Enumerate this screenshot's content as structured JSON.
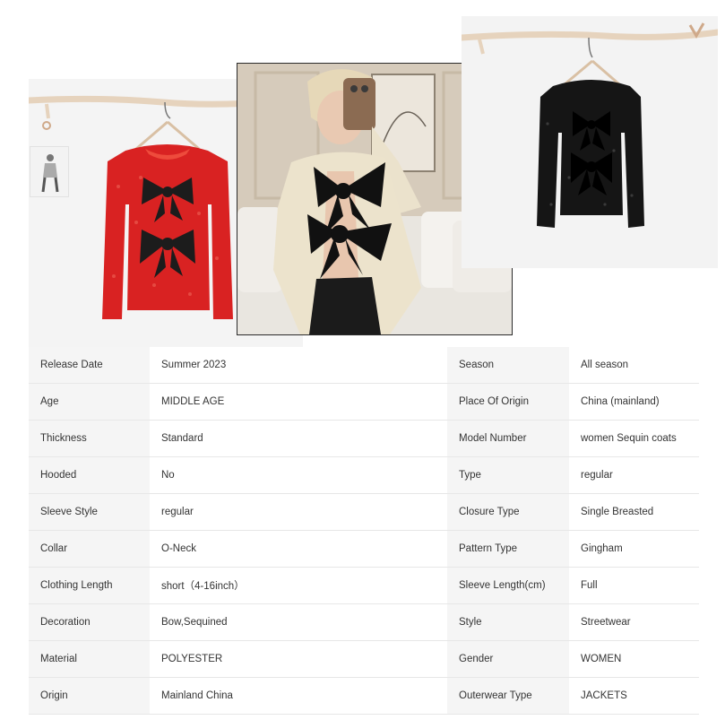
{
  "images": [
    {
      "name": "red-sequin-jacket",
      "description": "Red sequin cardigan with black bows on hanger"
    },
    {
      "name": "model-white-sequin-jacket",
      "description": "Woman taking mirror selfie in white sequin cardigan with black bows"
    },
    {
      "name": "black-sequin-jacket",
      "description": "Black sequin cardigan with black bows on hanger"
    }
  ],
  "colors": {
    "key_bg": "#f5f5f5",
    "value_bg": "#ffffff",
    "border": "#e7e7e7",
    "text": "#333333"
  },
  "specs": [
    {
      "k1": "Release Date",
      "v1": "Summer 2023",
      "k2": "Season",
      "v2": "All season"
    },
    {
      "k1": "Age",
      "v1": "MIDDLE AGE",
      "k2": "Place Of Origin",
      "v2": "China (mainland)"
    },
    {
      "k1": "Thickness",
      "v1": "Standard",
      "k2": "Model Number",
      "v2": "women Sequin coats"
    },
    {
      "k1": "Hooded",
      "v1": "No",
      "k2": "Type",
      "v2": "regular"
    },
    {
      "k1": "Sleeve Style",
      "v1": "regular",
      "k2": "Closure Type",
      "v2": "Single Breasted"
    },
    {
      "k1": "Collar",
      "v1": "O-Neck",
      "k2": "Pattern Type",
      "v2": "Gingham"
    },
    {
      "k1": "Clothing Length",
      "v1": "short（4-16inch）",
      "k2": "Sleeve Length(cm)",
      "v2": "Full"
    },
    {
      "k1": "Decoration",
      "v1": "Bow,Sequined",
      "k2": "Style",
      "v2": "Streetwear"
    },
    {
      "k1": "Material",
      "v1": "POLYESTER",
      "k2": "Gender",
      "v2": "WOMEN"
    },
    {
      "k1": "Origin",
      "v1": "Mainland China",
      "k2": "Outerwear Type",
      "v2": "JACKETS"
    }
  ]
}
